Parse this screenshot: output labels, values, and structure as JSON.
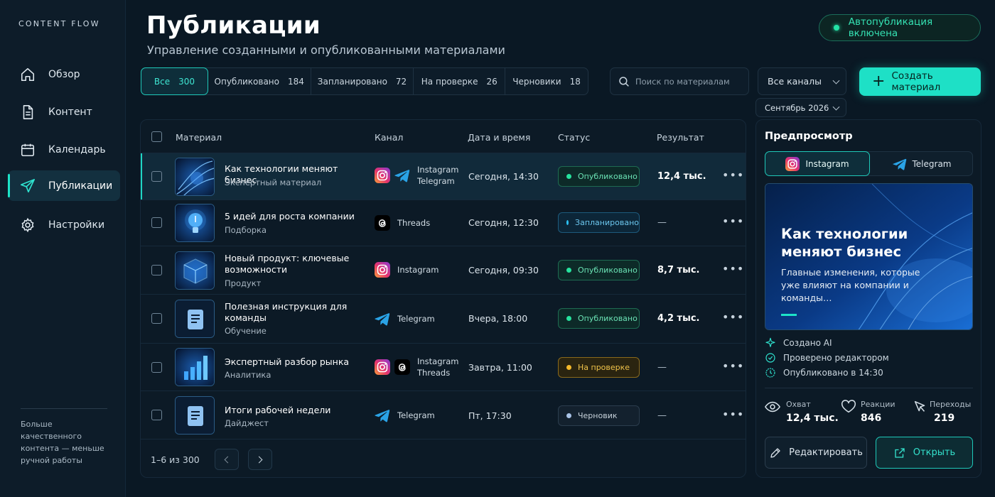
{
  "brand": "CONTENT FLOW",
  "nav": [
    {
      "label": "Обзор",
      "icon": "home-icon"
    },
    {
      "label": "Контент",
      "icon": "document-icon"
    },
    {
      "label": "Календарь",
      "icon": "calendar-icon"
    },
    {
      "label": "Публикации",
      "icon": "send-icon",
      "active": true
    },
    {
      "label": "Настройки",
      "icon": "gear-icon"
    }
  ],
  "sidebar_tagline": "Больше качественного контента — меньше ручной работы",
  "header": {
    "title": "Публикации",
    "subtitle": "Управление созданными и опубликованными материалами",
    "autopub_label": "Автопубликация включена"
  },
  "filters": [
    {
      "label": "Все",
      "count": "300",
      "active": true
    },
    {
      "label": "Опубликовано",
      "count": "184"
    },
    {
      "label": "Запланировано",
      "count": "72"
    },
    {
      "label": "На проверке",
      "count": "26"
    },
    {
      "label": "Черновики",
      "count": "18"
    }
  ],
  "search": {
    "placeholder": "Поиск по материалам",
    "value": ""
  },
  "channel_select": "Все каналы",
  "month_select": "Сентябрь 2026",
  "create_button": "Создать материал",
  "table": {
    "headers": {
      "material": "Материал",
      "channel": "Канал",
      "datetime": "Дата и время",
      "status": "Статус",
      "result": "Результат"
    },
    "rows": [
      {
        "title": "Как технологии меняют бизнес",
        "subtitle": "Экспертный материал",
        "thumb": "abstract-waves-icon",
        "channels": [
          "Instagram",
          "Telegram"
        ],
        "datetime": "Сегодня, 14:30",
        "status": "Опубликовано",
        "status_type": "pub",
        "result": "12,4 тыс.",
        "selected": true
      },
      {
        "title": "5 идей для роста компании",
        "subtitle": "Подборка",
        "thumb": "lightbulb-icon",
        "channels": [
          "Threads"
        ],
        "datetime": "Сегодня, 12:30",
        "status": "Запланировано",
        "status_type": "plan",
        "result": "—"
      },
      {
        "title": "Новый продукт: ключевые возможности",
        "subtitle": "Продукт",
        "thumb": "cube-icon",
        "channels": [
          "Instagram"
        ],
        "datetime": "Сегодня, 09:30",
        "status": "Опубликовано",
        "status_type": "pub",
        "result": "8,7 тыс."
      },
      {
        "title": "Полезная инструкция для команды",
        "subtitle": "Обучение",
        "thumb": "document-icon",
        "channels": [
          "Telegram"
        ],
        "datetime": "Вчера, 18:00",
        "status": "Опубликовано",
        "status_type": "pub",
        "result": "4,2 тыс."
      },
      {
        "title": "Экспертный разбор рынка",
        "subtitle": "Аналитика",
        "thumb": "bar-chart-icon",
        "channels": [
          "Instagram",
          "Threads"
        ],
        "datetime": "Завтра, 11:00",
        "status": "На проверке",
        "status_type": "rev",
        "result": "—"
      },
      {
        "title": "Итоги рабочей недели",
        "subtitle": "Дайджест",
        "thumb": "document-icon",
        "channels": [
          "Telegram"
        ],
        "datetime": "Пт, 17:30",
        "status": "Черновик",
        "status_type": "draft",
        "result": "—"
      }
    ],
    "pagination": "1–6 из 300"
  },
  "preview": {
    "title": "Предпросмотр",
    "tabs": [
      {
        "label": "Instagram",
        "active": true
      },
      {
        "label": "Telegram"
      }
    ],
    "hero_title": "Как технологии меняют бизнес",
    "hero_text": "Главные изменения, которые уже влияют на компании и команды…",
    "checks": [
      {
        "label": "Создано AI",
        "icon": "sparkle-icon"
      },
      {
        "label": "Проверено редактором",
        "icon": "check-circle-icon"
      },
      {
        "label": "Опубликовано в 14:30",
        "icon": "clock-check-icon"
      }
    ],
    "stats": [
      {
        "label": "Охват",
        "value": "12,4 тыс.",
        "icon": "eye-icon"
      },
      {
        "label": "Реакции",
        "value": "846",
        "icon": "heart-icon"
      },
      {
        "label": "Переходы",
        "value": "219",
        "icon": "cursor-icon"
      }
    ],
    "edit_button": "Редактировать",
    "open_button": "Открыть"
  },
  "colors": {
    "accent": "#1ee0c6",
    "background": "#0a1824",
    "published": "#26e39e",
    "scheduled": "#2cc2f5",
    "review": "#f5b92a"
  }
}
